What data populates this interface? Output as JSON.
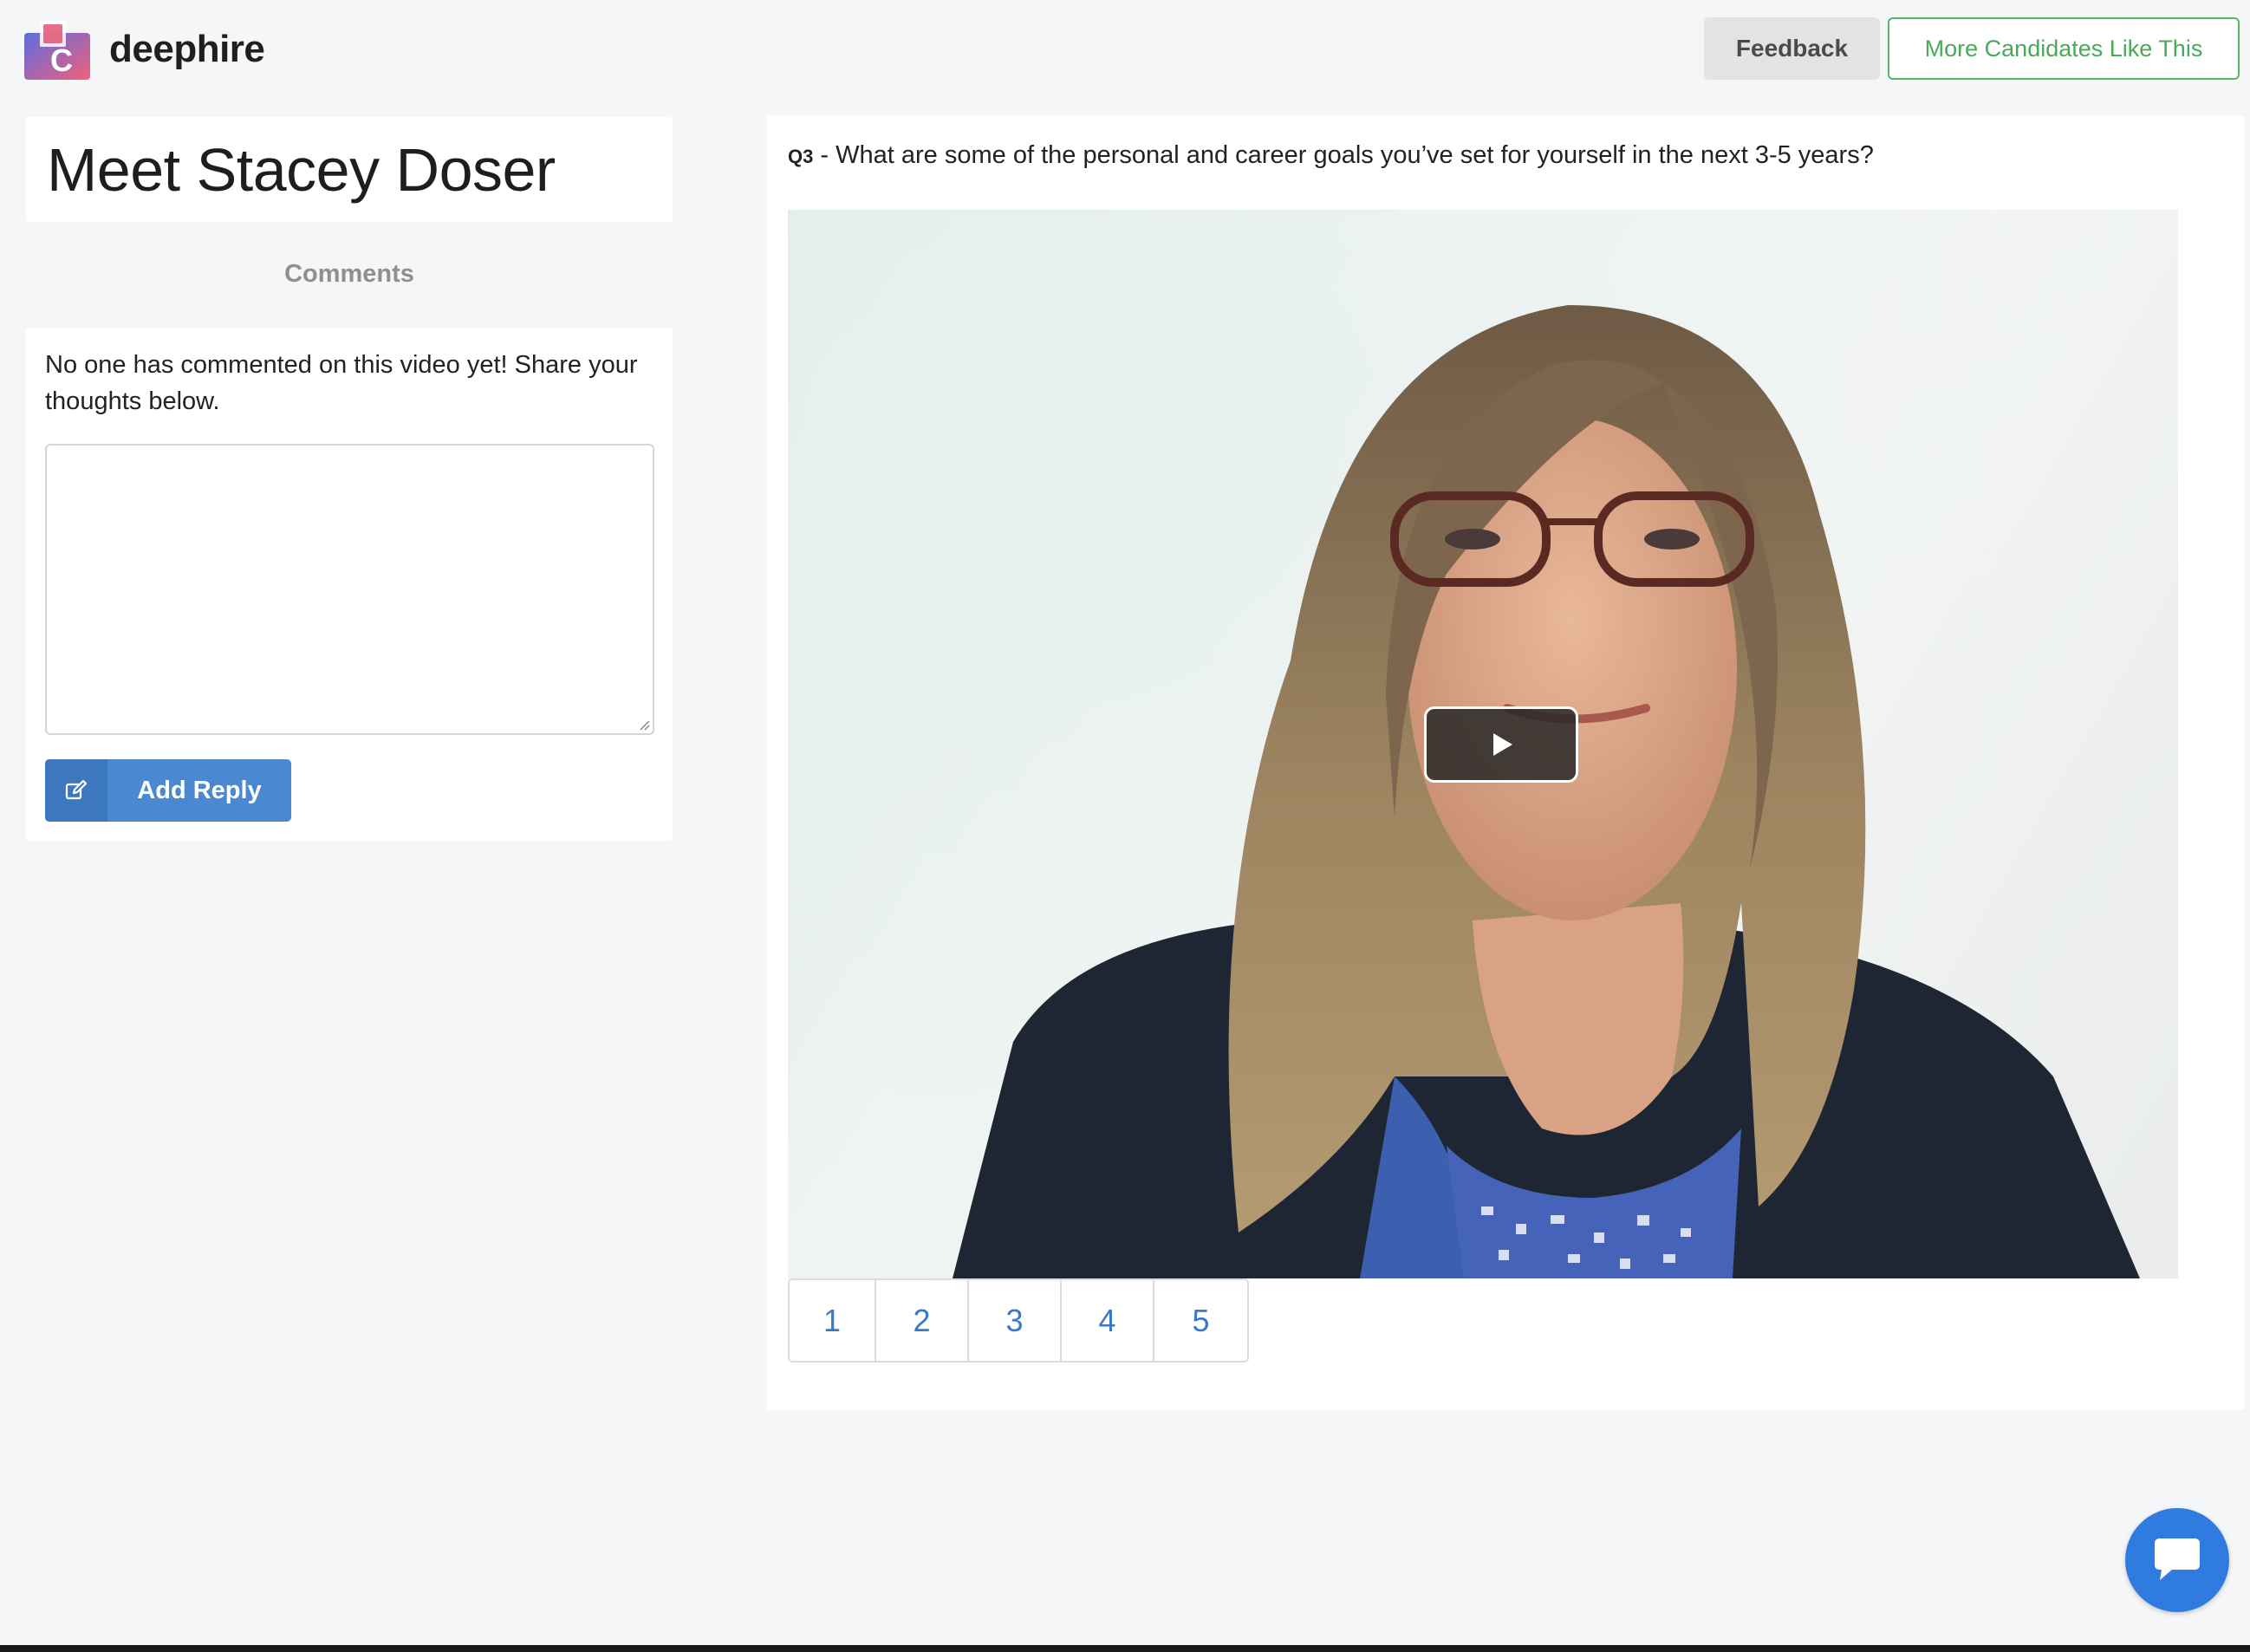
{
  "header": {
    "brand": "deephire",
    "feedback_label": "Feedback",
    "more_candidates_label": "More Candidates Like This"
  },
  "candidate": {
    "title": "Meet Stacey Doser"
  },
  "comments": {
    "heading": "Comments",
    "empty_message": "No one has commented on this video yet! Share your thoughts below.",
    "reply_value": "",
    "add_reply_label": "Add Reply"
  },
  "video": {
    "question_number": "Q3",
    "question_separator": " - ",
    "question_text": "What are some of the personal and career goals you’ve set for yourself in the next 3-5 years?",
    "pages": [
      "1",
      "2",
      "3",
      "4",
      "5"
    ]
  },
  "colors": {
    "primary": "#4a89d1",
    "success": "#55b564",
    "chat": "#2f7be0",
    "background": "#f5f6f8"
  },
  "icons": {
    "logo": "deephire-logo",
    "reply": "edit-icon",
    "play": "play-icon",
    "chat": "chat-bubble-icon"
  }
}
